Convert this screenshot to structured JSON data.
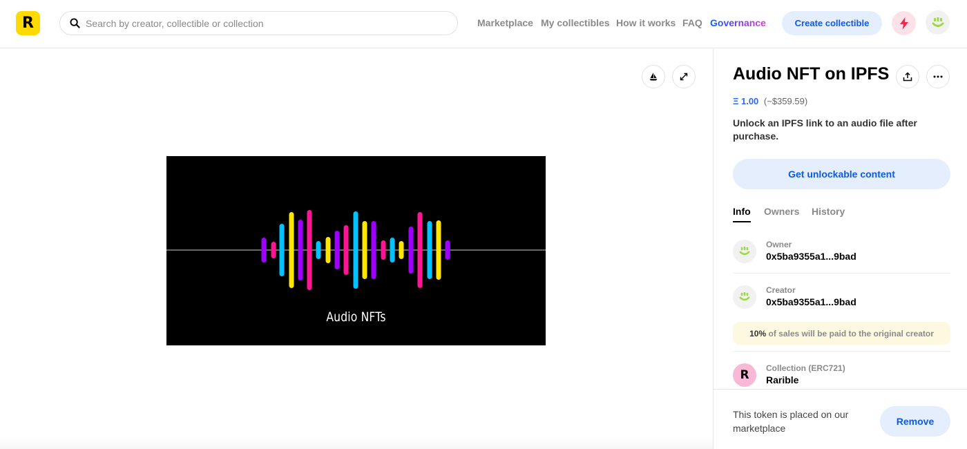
{
  "header": {
    "logo_letter": "R",
    "search_placeholder": "Search by creator, collectible or collection",
    "nav": {
      "marketplace": "Marketplace",
      "my_collectibles": "My collectibles",
      "how_it_works": "How it works",
      "faq": "FAQ",
      "governance": "Governance"
    },
    "create_button": "Create collectible",
    "icons": [
      "search-icon",
      "lightning-icon",
      "user-avatar-icon"
    ]
  },
  "media": {
    "caption": "Audio NFTs",
    "icons": [
      "sailboat-icon",
      "expand-icon"
    ],
    "waveform_colors": [
      "#a000ff",
      "#ff1493",
      "#00c3ff",
      "#ffe600"
    ]
  },
  "item": {
    "title": "Audio NFT on IPFS",
    "price_eth": "Ξ 1.00",
    "price_usd": "(~$359.59)",
    "description": "Unlock an IPFS link to an audio file after purchase.",
    "unlock_button": "Get unlockable content",
    "icons": [
      "share-icon",
      "more-icon"
    ]
  },
  "tabs": [
    {
      "label": "Info",
      "active": true
    },
    {
      "label": "Owners",
      "active": false
    },
    {
      "label": "History",
      "active": false
    }
  ],
  "info": {
    "owner_label": "Owner",
    "owner_value": "0x5ba9355a1...9bad",
    "creator_label": "Creator",
    "creator_value": "0x5ba9355a1...9bad",
    "royalty_percent": "10%",
    "royalty_text": " of sales will be paid to the original creator",
    "collection_label": "Collection (ERC721)",
    "collection_value": "Rarible",
    "collection_letter": "R"
  },
  "footer": {
    "text": "This token is placed on our marketplace",
    "remove_button": "Remove"
  },
  "colors": {
    "brand_yellow": "#feda03",
    "accent_blue": "#0d59e8",
    "button_bg": "#e5eefc"
  }
}
